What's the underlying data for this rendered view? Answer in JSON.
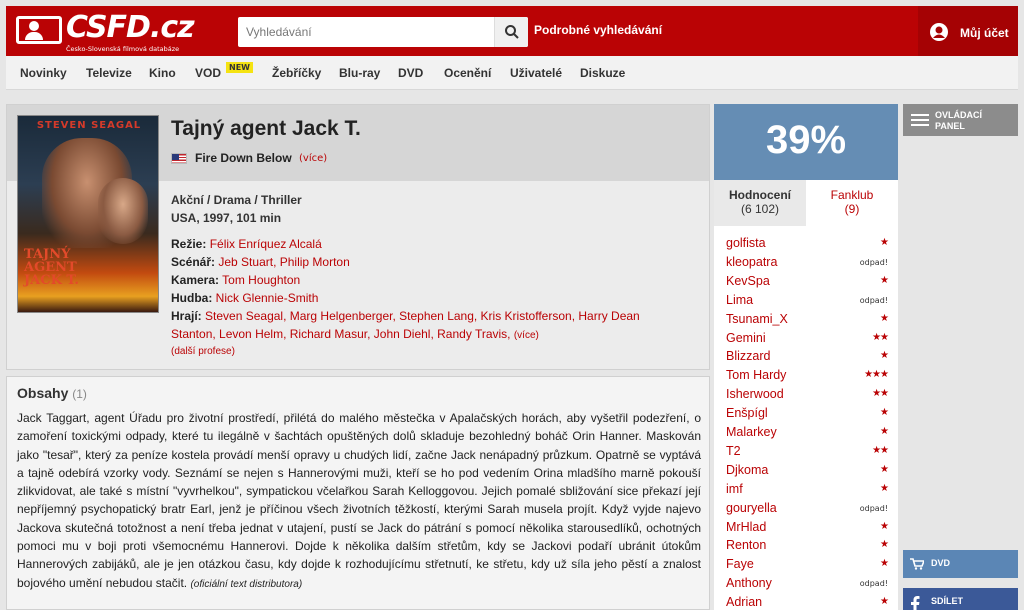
{
  "header": {
    "logo_text": "CSFD.cz",
    "logo_sub": "Česko-Slovenská filmová databáze",
    "search_placeholder": "Vyhledávání",
    "advanced_search": "Podrobné vyhledávání",
    "account_label": "Můj účet"
  },
  "menu": [
    {
      "label": "Novinky"
    },
    {
      "label": "Televize"
    },
    {
      "label": "Kino"
    },
    {
      "label": "VOD",
      "badge": "NEW"
    },
    {
      "label": "Žebříčky"
    },
    {
      "label": "Blu-ray"
    },
    {
      "label": "DVD"
    },
    {
      "label": "Ocenění"
    },
    {
      "label": "Uživatelé"
    },
    {
      "label": "Diskuze"
    }
  ],
  "film": {
    "title": "Tajný agent Jack T.",
    "original_title": "Fire Down Below",
    "original_more": "(více)",
    "genres": "Akční / Drama / Thriller",
    "origin": "USA, 1997, 101 min",
    "poster": {
      "top_text": "STEVEN SEAGAL",
      "title_text": "TAJNÝ AGENT JACK T."
    },
    "director_label": "Režie:",
    "director": "Félix Enríquez Alcalá",
    "writers_label": "Scénář:",
    "writers": "Jeb Stuart, Philip Morton",
    "camera_label": "Kamera:",
    "camera": "Tom Houghton",
    "music_label": "Hudba:",
    "music": "Nick Glennie-Smith",
    "cast_label": "Hrají:",
    "cast_line1": "Steven Seagal, Marg Helgenberger, Stephen Lang, Kris Kristofferson, Harry Dean",
    "cast_line2": "Stanton, Levon Helm, Richard Masur, John Diehl, Randy Travis,",
    "cast_more": "(více)",
    "more_professions": "(další profese)"
  },
  "plot": {
    "heading": "Obsahy",
    "count": "(1)",
    "text": "Jack Taggart, agent Úřadu pro životní prostředí, přilétá do malého městečka v Apalačských horách, aby vyšetřil podezření, o zamoření toxickými odpady, které tu ilegálně v šachtách opuštěných dolů skladuje bezohledný boháč Orin Hanner. Maskován jako \"tesař\", který za peníze kostela provádí menší opravy u chudých lidí, začne Jack nenápadný průzkum. Opatrně se vyptává a tajně odebírá vzorky vody. Seznámí se nejen s Hannerovými muži, kteří se ho pod vedením Orina mladšího marně pokouší zlikvidovat, ale také s místní \"vyvrhelkou\", sympatickou včelařkou Sarah Kelloggovou. Jejich pomalé sbližování sice překazí její nepříjemný psychopatický bratr Earl, jenž je příčinou všech životních těžkostí, kterými Sarah musela projít. Když vyjde najevo Jackova skutečná totožnost a není třeba jednat v utajení, pustí se Jack do pátrání s pomocí několika starousedlíků, ochotných pomoci mu v boji proti všemocnému Hannerovi. Dojde k několika dalším střetům, kdy se Jackovi podaří ubránit útokům Hannerových zabijáků, ale je jen otázkou času, kdy dojde k rozhodujícímu střetnutí, ke střetu, kdy už síla jeho pěstí a znalost bojového umění nebudou stačit.",
    "source": "(oficiální text distributora)"
  },
  "rating": {
    "percent": "39%",
    "accent_color": "#658db4",
    "tab_ratings": "Hodnocení",
    "tab_ratings_count": "(6 102)",
    "tab_fanclub": "Fanklub",
    "tab_fanclub_count": "(9)",
    "users": [
      {
        "name": "golfista",
        "value": "★"
      },
      {
        "name": "kleopatra",
        "value": "odpad!"
      },
      {
        "name": "KevSpa",
        "value": "★"
      },
      {
        "name": "Lima",
        "value": "odpad!"
      },
      {
        "name": "Tsunami_X",
        "value": "★"
      },
      {
        "name": "Gemini",
        "value": "★★"
      },
      {
        "name": "Blizzard",
        "value": "★"
      },
      {
        "name": "Tom Hardy",
        "value": "★★★"
      },
      {
        "name": "Isherwood",
        "value": "★★"
      },
      {
        "name": "Enšpígl",
        "value": "★"
      },
      {
        "name": "Malarkey",
        "value": "★"
      },
      {
        "name": "T2",
        "value": "★★"
      },
      {
        "name": "Djkoma",
        "value": "★"
      },
      {
        "name": "imf",
        "value": "★"
      },
      {
        "name": "gouryella",
        "value": "odpad!"
      },
      {
        "name": "MrHlad",
        "value": "★"
      },
      {
        "name": "Renton",
        "value": "★"
      },
      {
        "name": "Faye",
        "value": "★"
      },
      {
        "name": "Anthony",
        "value": "odpad!"
      },
      {
        "name": "Adrian",
        "value": "★"
      }
    ]
  },
  "side": {
    "control_panel_line1": "OVLÁDACÍ",
    "control_panel_line2": "PANEL",
    "dvd": "DVD",
    "share": "SDÍLET"
  }
}
